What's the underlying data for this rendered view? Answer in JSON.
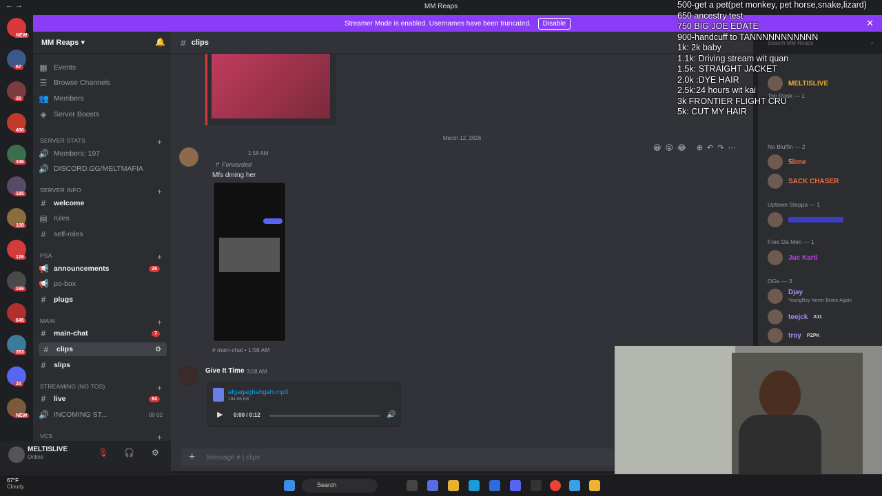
{
  "window": {
    "title": "MM Reaps"
  },
  "streamer_banner": {
    "text": "Streamer Mode is enabled. Usernames have been truncated.",
    "button": "Disable"
  },
  "server": {
    "name": "MM Reaps"
  },
  "sidebar": {
    "top_items": [
      "Events",
      "Browse Channels",
      "Members",
      "Server Boosts"
    ],
    "categories": [
      {
        "name": "SERVER STATS",
        "channels": [
          {
            "label": "Members: 197"
          },
          {
            "label": "DISCORD.GG/MELTMAFIA"
          }
        ]
      },
      {
        "name": "SERVER INFO",
        "channels": [
          {
            "label": "welcome",
            "bright": true
          },
          {
            "label": "rules"
          },
          {
            "label": "self-roles"
          }
        ]
      },
      {
        "name": "PSA",
        "channels": [
          {
            "label": "announcements",
            "bright": true,
            "badge": "26"
          },
          {
            "label": "po-box"
          },
          {
            "label": "plugs",
            "bright": true
          }
        ]
      },
      {
        "name": "MAIN",
        "channels": [
          {
            "label": "main-chat",
            "bright": true,
            "badge": "7"
          },
          {
            "label": "clips",
            "selected": true
          },
          {
            "label": "slips"
          }
        ]
      },
      {
        "name": "STREAMING (NO TOS)",
        "channels": [
          {
            "label": "live",
            "bright": true,
            "badge": "94"
          },
          {
            "label": "INCOMING ST...",
            "counts": "00  02"
          }
        ]
      },
      {
        "name": "VCs",
        "channels": []
      }
    ]
  },
  "user": {
    "name": "MELTISLIVE",
    "status": "Online"
  },
  "channel": {
    "name": "clips",
    "input_placeholder": "Message #  |  clips"
  },
  "messages": {
    "date_divider": "March 12, 2026",
    "forward": {
      "time": "1:58 AM",
      "label": "Forwarded",
      "text": "Mfs dming her",
      "origin": "# main-chat • 1:58 AM"
    },
    "audio": {
      "author": "Give It Time",
      "time": "3:08 AM",
      "filename": "afgagaghahgah.mp3",
      "size": "194.96 KB",
      "progress_text": "0:00 / 0:12",
      "progress": 0.0
    }
  },
  "overlay_goals": [
    "500-get a pet(pet monkey, pet horse,snake,lizard)",
    "650 ancestry test",
    "750 BIG JOE EDATE",
    "900-handcuff to TANNNNNNNNNNN",
    "1k: 2k baby",
    "1.1k: Driving stream wit quan",
    "1.5k: STRAIGHT JACKET",
    "2.0k :DYE HAIR",
    "2.5k:24 hours wit kai",
    "3k FRONTIER FLIGHT CRU",
    "5k: CUT MY HAIR"
  ],
  "members": {
    "search_placeholder": "Search MM Reaps",
    "groups": [
      {
        "name": "Top Rank — 1",
        "members": [
          {
            "name": "MELTISLIVE",
            "color": "#f0b232"
          }
        ]
      },
      {
        "name": "No Bluffin — 2",
        "members": [
          {
            "name": "5lime",
            "color": "#f26d3d"
          },
          {
            "name": "SACK CHASER",
            "color": "#f26d3d"
          }
        ]
      },
      {
        "name": "Uptown Steppa — 1",
        "members": [
          {
            "name": "",
            "color": "#5865f2"
          }
        ]
      },
      {
        "name": "Free Da Men — 1",
        "members": [
          {
            "name": "Juc Kartl",
            "color": "#c13cf0"
          }
        ]
      },
      {
        "name": "OGs — 3",
        "members": [
          {
            "name": "Djay",
            "color": "#a98bf7",
            "sub": "YoungBoy Never Broke Again"
          },
          {
            "name": "teejck",
            "color": "#a98bf7",
            "tag": "A11"
          },
          {
            "name": "troy",
            "color": "#a98bf7",
            "tag": "PZPK"
          }
        ]
      }
    ]
  },
  "taskbar": {
    "weather_temp": "67°F",
    "weather_desc": "Cloudy",
    "search": "Search"
  },
  "guild_badges": [
    "NEW",
    "67",
    "35",
    "496",
    "346",
    "185",
    "108",
    "126",
    "166",
    "645",
    "353",
    "20",
    "NEW"
  ]
}
